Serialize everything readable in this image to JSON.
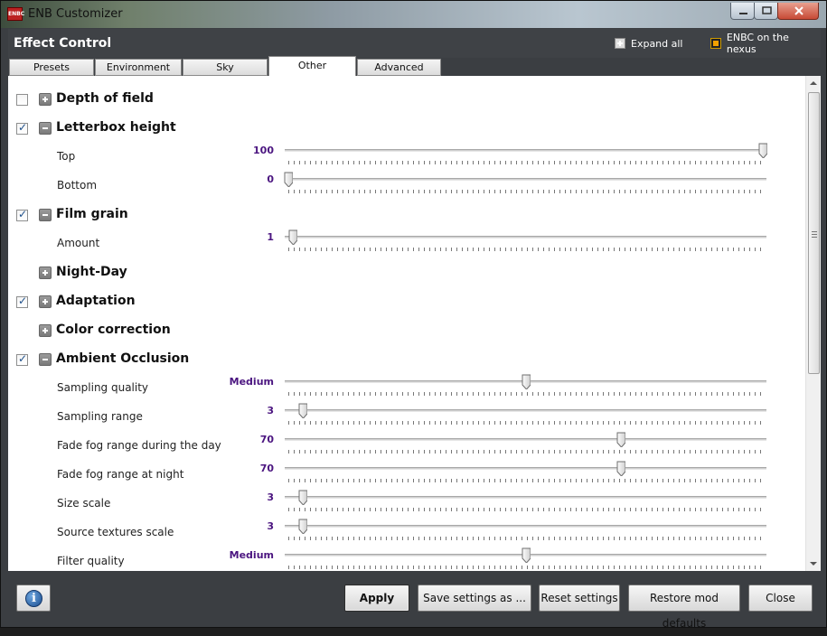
{
  "window": {
    "app_icon_text": "ENBC",
    "title": "ENB Customizer"
  },
  "header": {
    "title": "Effect Control",
    "expand_all": "Expand all",
    "nexus_link": "ENBC on the nexus"
  },
  "tabs": [
    {
      "label": "Presets",
      "active": false
    },
    {
      "label": "Environment",
      "active": false
    },
    {
      "label": "Sky",
      "active": false
    },
    {
      "label": "Other",
      "active": true
    },
    {
      "label": "Advanced",
      "active": false
    }
  ],
  "sections": [
    {
      "title": "Depth of field",
      "has_checkbox": true,
      "checked": false,
      "expanded": false,
      "params": []
    },
    {
      "title": "Letterbox height",
      "has_checkbox": true,
      "checked": true,
      "expanded": true,
      "params": [
        {
          "label": "Top",
          "value": "100",
          "slider_fraction": 1.0
        },
        {
          "label": "Bottom",
          "value": "0",
          "slider_fraction": 0.0
        }
      ]
    },
    {
      "title": "Film grain",
      "has_checkbox": true,
      "checked": true,
      "expanded": true,
      "params": [
        {
          "label": "Amount",
          "value": "1",
          "slider_fraction": 0.01
        }
      ]
    },
    {
      "title": "Night-Day",
      "has_checkbox": false,
      "checked": false,
      "expanded": false,
      "params": []
    },
    {
      "title": "Adaptation",
      "has_checkbox": true,
      "checked": true,
      "expanded": false,
      "params": []
    },
    {
      "title": "Color correction",
      "has_checkbox": false,
      "checked": false,
      "expanded": false,
      "params": []
    },
    {
      "title": "Ambient Occlusion",
      "has_checkbox": true,
      "checked": true,
      "expanded": true,
      "params": [
        {
          "label": "Sampling quality",
          "value": "Medium",
          "slider_fraction": 0.5
        },
        {
          "label": "Sampling range",
          "value": "3",
          "slider_fraction": 0.03
        },
        {
          "label": "Fade fog range during the day",
          "value": "70",
          "slider_fraction": 0.7
        },
        {
          "label": "Fade fog range at night",
          "value": "70",
          "slider_fraction": 0.7
        },
        {
          "label": "Size scale",
          "value": "3",
          "slider_fraction": 0.03
        },
        {
          "label": "Source textures scale",
          "value": "3",
          "slider_fraction": 0.03
        },
        {
          "label": "Filter quality",
          "value": "Medium",
          "slider_fraction": 0.5
        }
      ]
    }
  ],
  "footer": {
    "info_icon": "i",
    "apply": "Apply",
    "save_as": "Save settings as ...",
    "reset": "Reset settings",
    "restore": "Restore mod defaults",
    "close": "Close"
  },
  "colors": {
    "value_text": "#4b1580",
    "chrome": "#3b3e42"
  }
}
